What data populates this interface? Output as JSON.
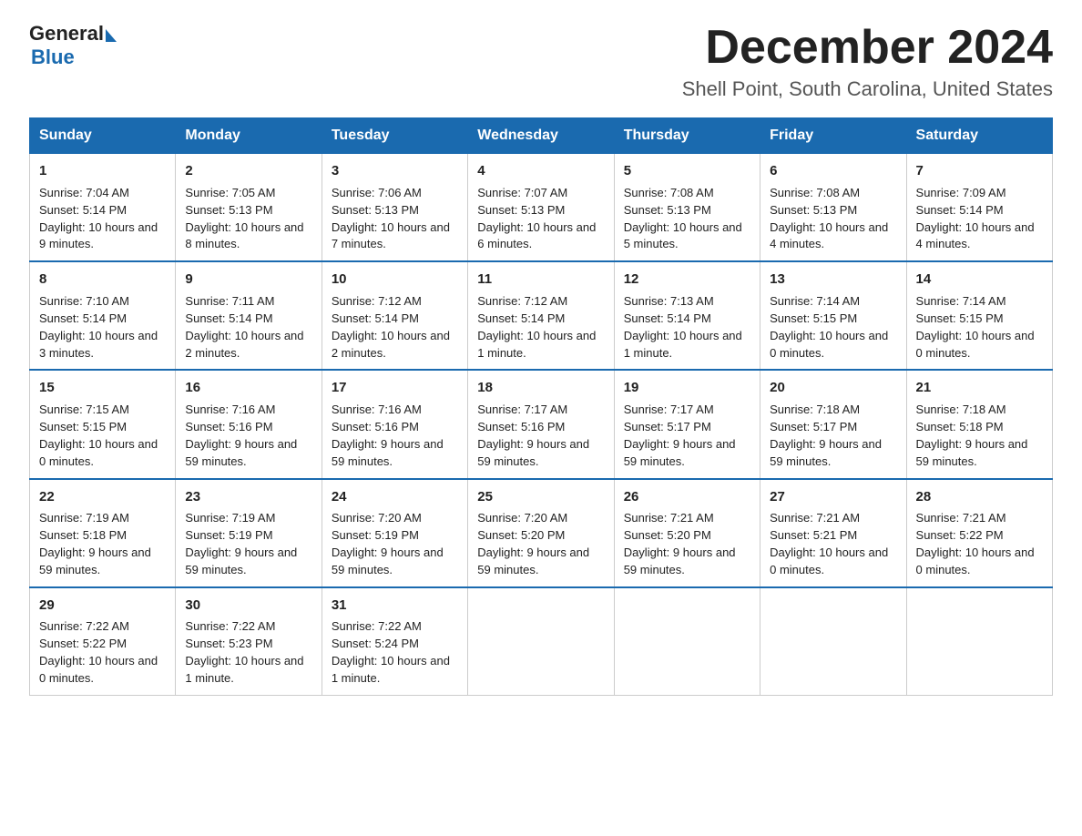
{
  "header": {
    "logo_general": "General",
    "logo_blue": "Blue",
    "month_title": "December 2024",
    "location": "Shell Point, South Carolina, United States"
  },
  "days_of_week": [
    "Sunday",
    "Monday",
    "Tuesday",
    "Wednesday",
    "Thursday",
    "Friday",
    "Saturday"
  ],
  "weeks": [
    [
      {
        "day": "1",
        "sunrise": "7:04 AM",
        "sunset": "5:14 PM",
        "daylight": "10 hours and 9 minutes."
      },
      {
        "day": "2",
        "sunrise": "7:05 AM",
        "sunset": "5:13 PM",
        "daylight": "10 hours and 8 minutes."
      },
      {
        "day": "3",
        "sunrise": "7:06 AM",
        "sunset": "5:13 PM",
        "daylight": "10 hours and 7 minutes."
      },
      {
        "day": "4",
        "sunrise": "7:07 AM",
        "sunset": "5:13 PM",
        "daylight": "10 hours and 6 minutes."
      },
      {
        "day": "5",
        "sunrise": "7:08 AM",
        "sunset": "5:13 PM",
        "daylight": "10 hours and 5 minutes."
      },
      {
        "day": "6",
        "sunrise": "7:08 AM",
        "sunset": "5:13 PM",
        "daylight": "10 hours and 4 minutes."
      },
      {
        "day": "7",
        "sunrise": "7:09 AM",
        "sunset": "5:14 PM",
        "daylight": "10 hours and 4 minutes."
      }
    ],
    [
      {
        "day": "8",
        "sunrise": "7:10 AM",
        "sunset": "5:14 PM",
        "daylight": "10 hours and 3 minutes."
      },
      {
        "day": "9",
        "sunrise": "7:11 AM",
        "sunset": "5:14 PM",
        "daylight": "10 hours and 2 minutes."
      },
      {
        "day": "10",
        "sunrise": "7:12 AM",
        "sunset": "5:14 PM",
        "daylight": "10 hours and 2 minutes."
      },
      {
        "day": "11",
        "sunrise": "7:12 AM",
        "sunset": "5:14 PM",
        "daylight": "10 hours and 1 minute."
      },
      {
        "day": "12",
        "sunrise": "7:13 AM",
        "sunset": "5:14 PM",
        "daylight": "10 hours and 1 minute."
      },
      {
        "day": "13",
        "sunrise": "7:14 AM",
        "sunset": "5:15 PM",
        "daylight": "10 hours and 0 minutes."
      },
      {
        "day": "14",
        "sunrise": "7:14 AM",
        "sunset": "5:15 PM",
        "daylight": "10 hours and 0 minutes."
      }
    ],
    [
      {
        "day": "15",
        "sunrise": "7:15 AM",
        "sunset": "5:15 PM",
        "daylight": "10 hours and 0 minutes."
      },
      {
        "day": "16",
        "sunrise": "7:16 AM",
        "sunset": "5:16 PM",
        "daylight": "9 hours and 59 minutes."
      },
      {
        "day": "17",
        "sunrise": "7:16 AM",
        "sunset": "5:16 PM",
        "daylight": "9 hours and 59 minutes."
      },
      {
        "day": "18",
        "sunrise": "7:17 AM",
        "sunset": "5:16 PM",
        "daylight": "9 hours and 59 minutes."
      },
      {
        "day": "19",
        "sunrise": "7:17 AM",
        "sunset": "5:17 PM",
        "daylight": "9 hours and 59 minutes."
      },
      {
        "day": "20",
        "sunrise": "7:18 AM",
        "sunset": "5:17 PM",
        "daylight": "9 hours and 59 minutes."
      },
      {
        "day": "21",
        "sunrise": "7:18 AM",
        "sunset": "5:18 PM",
        "daylight": "9 hours and 59 minutes."
      }
    ],
    [
      {
        "day": "22",
        "sunrise": "7:19 AM",
        "sunset": "5:18 PM",
        "daylight": "9 hours and 59 minutes."
      },
      {
        "day": "23",
        "sunrise": "7:19 AM",
        "sunset": "5:19 PM",
        "daylight": "9 hours and 59 minutes."
      },
      {
        "day": "24",
        "sunrise": "7:20 AM",
        "sunset": "5:19 PM",
        "daylight": "9 hours and 59 minutes."
      },
      {
        "day": "25",
        "sunrise": "7:20 AM",
        "sunset": "5:20 PM",
        "daylight": "9 hours and 59 minutes."
      },
      {
        "day": "26",
        "sunrise": "7:21 AM",
        "sunset": "5:20 PM",
        "daylight": "9 hours and 59 minutes."
      },
      {
        "day": "27",
        "sunrise": "7:21 AM",
        "sunset": "5:21 PM",
        "daylight": "10 hours and 0 minutes."
      },
      {
        "day": "28",
        "sunrise": "7:21 AM",
        "sunset": "5:22 PM",
        "daylight": "10 hours and 0 minutes."
      }
    ],
    [
      {
        "day": "29",
        "sunrise": "7:22 AM",
        "sunset": "5:22 PM",
        "daylight": "10 hours and 0 minutes."
      },
      {
        "day": "30",
        "sunrise": "7:22 AM",
        "sunset": "5:23 PM",
        "daylight": "10 hours and 1 minute."
      },
      {
        "day": "31",
        "sunrise": "7:22 AM",
        "sunset": "5:24 PM",
        "daylight": "10 hours and 1 minute."
      },
      null,
      null,
      null,
      null
    ]
  ],
  "labels": {
    "sunrise": "Sunrise:",
    "sunset": "Sunset:",
    "daylight": "Daylight:"
  }
}
